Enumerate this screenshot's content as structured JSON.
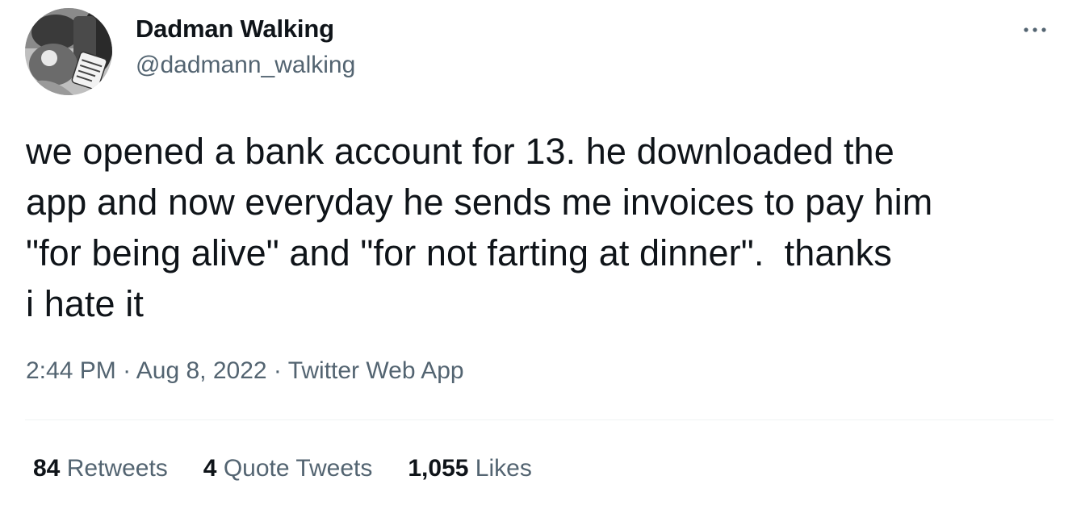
{
  "author": {
    "display_name": "Dadman Walking",
    "handle": "@dadmann_walking",
    "avatar_icon": "profile-photo-with-mug"
  },
  "more_icon": "more-options-icon",
  "tweet": {
    "text": "we opened a bank account for 13. he downloaded the\napp and now everyday he sends me invoices to pay him\n\"for being alive\" and \"for not farting at dinner\".  thanks\ni hate it",
    "time": "2:44 PM",
    "separator": " · ",
    "date": "Aug 8, 2022",
    "source": "Twitter Web App"
  },
  "stats": {
    "retweets": {
      "count": "84",
      "label": "Retweets"
    },
    "quote_tweets": {
      "count": "4",
      "label": "Quote Tweets"
    },
    "likes": {
      "count": "1,055",
      "label": "Likes"
    }
  },
  "colors": {
    "text_primary": "#0f1419",
    "text_secondary": "#536471",
    "divider": "#eff3f4",
    "background": "#ffffff"
  }
}
